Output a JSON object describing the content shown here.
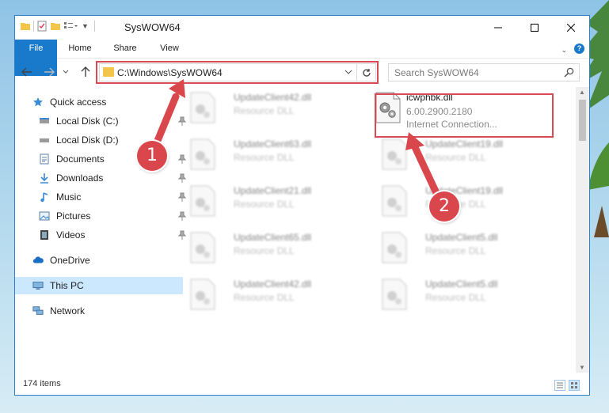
{
  "window": {
    "title": "SysWOW64"
  },
  "ribbon": {
    "tabs": [
      "File",
      "Home",
      "Share",
      "View"
    ],
    "help": "?"
  },
  "address": {
    "path": "C:\\Windows\\SysWOW64"
  },
  "search": {
    "placeholder": "Search SysWOW64"
  },
  "nav": {
    "items": [
      {
        "label": "Quick access",
        "icon": "star-icon"
      },
      {
        "label": "Local Disk (C:)",
        "icon": "drive-icon"
      },
      {
        "label": "Local Disk (D:)",
        "icon": "drive-icon"
      },
      {
        "label": "Documents",
        "icon": "document-icon"
      },
      {
        "label": "Downloads",
        "icon": "download-icon"
      },
      {
        "label": "Music",
        "icon": "music-icon"
      },
      {
        "label": "Pictures",
        "icon": "pictures-icon"
      },
      {
        "label": "Videos",
        "icon": "video-icon"
      },
      {
        "label": "OneDrive",
        "icon": "cloud-icon"
      },
      {
        "label": "This PC",
        "icon": "computer-icon"
      },
      {
        "label": "Network",
        "icon": "network-icon"
      }
    ]
  },
  "files": {
    "highlighted": {
      "name": "icwphbk.dll",
      "version": "6.00.2900.2180",
      "description": "Internet Connection..."
    },
    "left": [
      {
        "name": "UpdateClient42.dll",
        "type": "Resource DLL"
      },
      {
        "name": "UpdateClient63.dll",
        "type": "Resource DLL"
      },
      {
        "name": "UpdateClient21.dll",
        "type": "Resource DLL"
      },
      {
        "name": "UpdateClient65.dll",
        "type": "Resource DLL"
      },
      {
        "name": "UpdateClient42.dll",
        "type": "Resource DLL"
      }
    ],
    "right": [
      {
        "name": "UpdateClient19.dll",
        "type": "Resource DLL"
      },
      {
        "name": "UpdateClient19.dll",
        "type": "Resource DLL"
      },
      {
        "name": "UpdateClient5.dll",
        "type": "Resource DLL"
      },
      {
        "name": "UpdateClient5.dll",
        "type": "Resource DLL"
      }
    ]
  },
  "status": {
    "count": "174 items"
  },
  "callouts": [
    "1",
    "2"
  ],
  "colors": {
    "accent": "#1979ca",
    "callout": "#d9474c",
    "selection": "#cce8ff"
  }
}
